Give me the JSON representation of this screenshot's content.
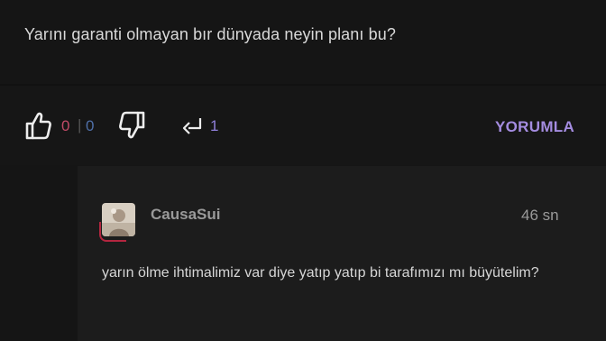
{
  "post": {
    "text": "Yarını garanti olmayan bır dünyada neyin planı bu?"
  },
  "actions": {
    "like_count": "0",
    "separator": "|",
    "dislike_count": "0",
    "reply_count": "1",
    "comment_label": "YORUMLA"
  },
  "reply": {
    "username": "CausaSui",
    "timestamp": "46 sn",
    "text": "yarın ölme ihtimalimiz var diye yatıp yatıp bi tarafımızı mı büyütelim?"
  },
  "icons": {
    "like": "thumbs-up-icon",
    "dislike": "thumbs-down-icon",
    "reply": "reply-icon"
  },
  "colors": {
    "background": "#151515",
    "reply_background": "#1c1c1c",
    "like_count": "#c04a66",
    "dislike_count": "#4f6fa8",
    "accent_purple": "#a48ce0"
  }
}
